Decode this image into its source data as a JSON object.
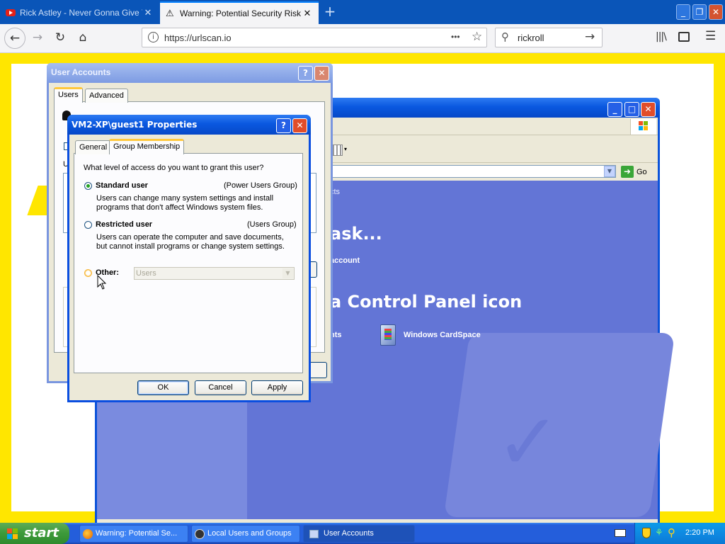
{
  "browser": {
    "tabs": [
      {
        "label": "Rick Astley - Never Gonna Give Yo",
        "icon": "youtube-icon",
        "active": false
      },
      {
        "label": "Warning: Potential Security Risk A",
        "icon": "warning-icon",
        "active": true
      }
    ],
    "new_tab_symbol": "+",
    "url": "https://urlscan.io",
    "search_query": "rickroll",
    "page_actions_symbol": "•••"
  },
  "control_panel": {
    "address_go": "Go",
    "task_heading": "ask...",
    "task_link": "account",
    "icon_heading": "a Control Panel icon",
    "left_fragment": "cts",
    "item_fragment": "nts",
    "item_cardspace": "Windows CardSpace"
  },
  "user_accounts": {
    "title": "User Accounts",
    "tabs": [
      "Users",
      "Advanced"
    ],
    "visible_fragment": "U"
  },
  "properties": {
    "title": "VM2-XP\\guest1 Properties",
    "tabs": [
      "General",
      "Group Membership"
    ],
    "question": "What level of access do you want to grant this user?",
    "options": [
      {
        "label": "Standard user",
        "group": "(Power Users Group)",
        "desc1": "Users can change many system settings and install",
        "desc2": "programs that don't affect Windows system files.",
        "selected": true
      },
      {
        "label": "Restricted user",
        "group": "(Users Group)",
        "desc1": "Users can operate the computer and save documents,",
        "desc2": "but cannot install programs or change system settings.",
        "selected": false
      },
      {
        "label": "Other:",
        "selected": false
      }
    ],
    "other_value": "Users",
    "buttons": {
      "ok": "OK",
      "cancel": "Cancel",
      "apply": "Apply"
    }
  },
  "taskbar": {
    "start_label": "start",
    "tasks": [
      {
        "label": "Warning: Potential Se...",
        "active": false
      },
      {
        "label": "Local Users and Groups",
        "active": false
      },
      {
        "label": "User Accounts",
        "active": true
      }
    ],
    "clock": "2:20 PM"
  },
  "colors": {
    "firefox_tabbar": "#0a55b8",
    "page_frame": "#ffe600",
    "xp_blue": "#0a4ee0",
    "control_panel_body": "#6375d6"
  }
}
